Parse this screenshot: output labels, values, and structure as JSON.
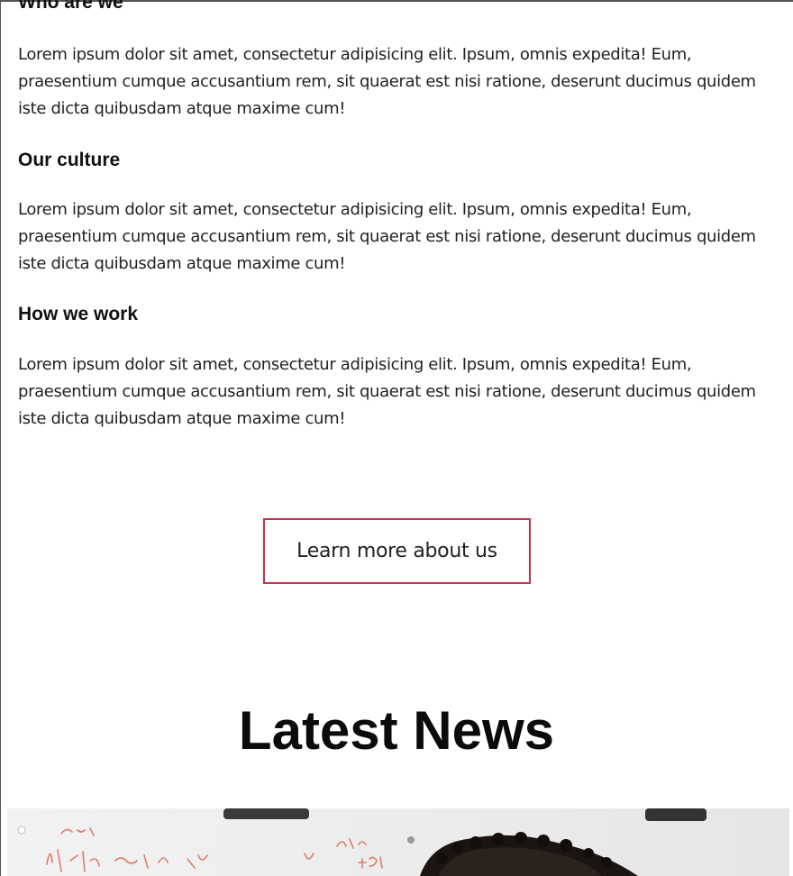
{
  "sections": [
    {
      "heading": "Who are we",
      "text": "Lorem ipsum dolor sit amet, consectetur adipisicing elit. Ipsum, omnis expedita! Eum, praesentium cumque accusantium rem, sit quaerat est nisi ratione, deserunt ducimus quidem iste dicta quibusdam atque maxime cum!"
    },
    {
      "heading": "Our culture",
      "text": "Lorem ipsum dolor sit amet, consectetur adipisicing elit. Ipsum, omnis expedita! Eum, praesentium cumque accusantium rem, sit quaerat est nisi ratione, deserunt ducimus quidem iste dicta quibusdam atque maxime cum!"
    },
    {
      "heading": "How we work",
      "text": "Lorem ipsum dolor sit amet, consectetur adipisicing elit. Ipsum, omnis expedita! Eum, praesentium cumque accusantium rem, sit quaerat est nisi ratione, deserunt ducimus quidem iste dicta quibusdam atque maxime cum!"
    }
  ],
  "cta": {
    "label": "Learn more about us",
    "border_color": "#c8314f"
  },
  "news": {
    "title": "Latest News",
    "image_handwriting": [
      "Ansel",
      "talk – yr tr See",
      "Alto",
      "+ SK"
    ]
  }
}
